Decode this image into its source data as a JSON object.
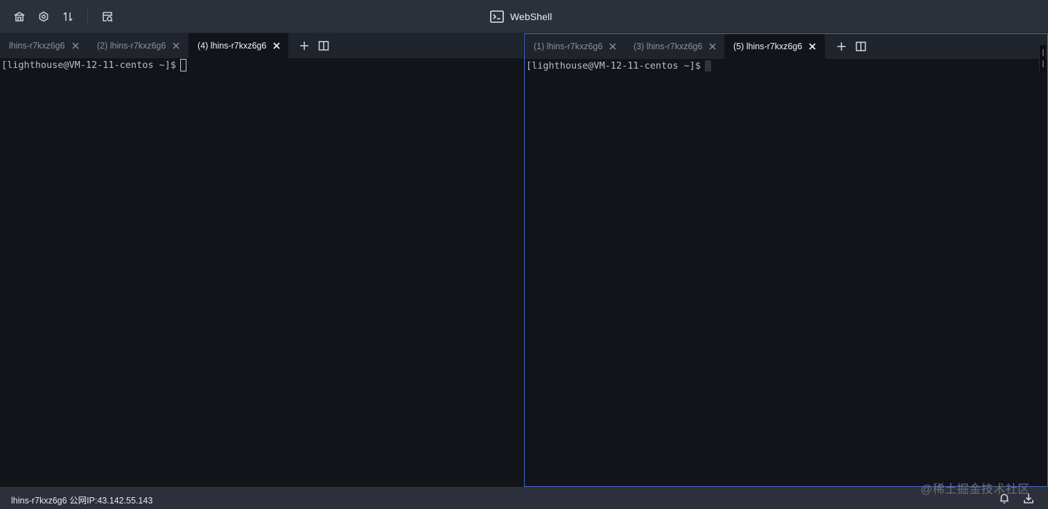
{
  "app": {
    "title": "WebShell"
  },
  "toolbar": {
    "icons": [
      "home-icon",
      "settings-icon",
      "transfer-icon",
      "history-icon"
    ]
  },
  "left_pane": {
    "tabs": [
      {
        "label": "lhins-r7kxz6g6",
        "active": false
      },
      {
        "label": "(2) lhins-r7kxz6g6",
        "active": false
      },
      {
        "label": "(4) lhins-r7kxz6g6",
        "active": true
      }
    ],
    "prompt": "[lighthouse@VM-12-11-centos ~]$"
  },
  "right_pane": {
    "tabs": [
      {
        "label": "(1) lhins-r7kxz6g6",
        "active": false
      },
      {
        "label": "(3) lhins-r7kxz6g6",
        "active": false
      },
      {
        "label": "(5) lhins-r7kxz6g6",
        "active": true
      }
    ],
    "prompt": "[lighthouse@VM-12-11-centos ~]$"
  },
  "status": {
    "text": "lhins-r7kxz6g6 公网IP:43.142.55.143",
    "watermark": "@稀土掘金技术社区"
  },
  "colors": {
    "toolbar_bg": "#2b303b",
    "terminal_bg": "#121419",
    "tabbar_bg": "#20242c",
    "focus_border": "#3f6bd6"
  }
}
